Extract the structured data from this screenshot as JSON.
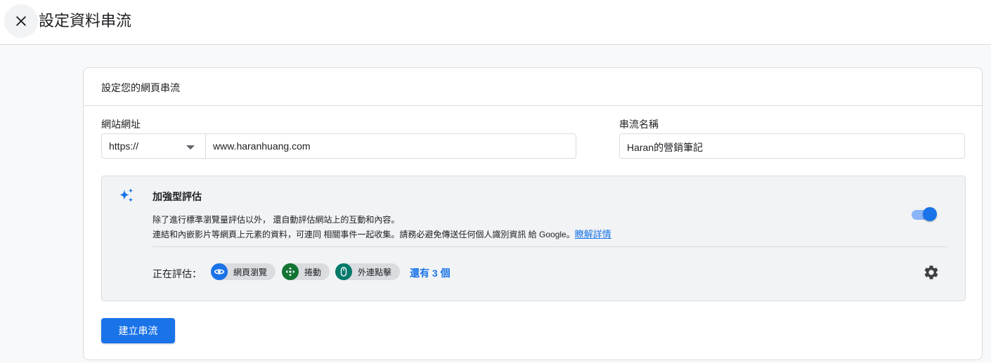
{
  "header": {
    "title": "設定資料串流",
    "close_icon": "close-icon"
  },
  "card": {
    "title": "設定您的網頁串流",
    "website_url": {
      "label": "網站網址",
      "protocol": "https://",
      "value": "www.haranhuang.com"
    },
    "stream_name": {
      "label": "串流名稱",
      "value": "Haran的營銷筆記"
    },
    "enhanced_measurement": {
      "icon": "sparkle-icon",
      "title": "加強型評估",
      "desc_line1": "除了進行標準瀏覽量評估以外， 還自動評估網站上的互動和內容。",
      "desc_line2": "連結和內嵌影片等網頁上元素的資料，可連同 相關事件一起收集。請務必避免傳送任何個人識別資訊 給 Google。",
      "learn_more": "瞭解詳情",
      "toggle_on": true,
      "measuring_label": "正在評估：",
      "events": [
        {
          "label": "網頁瀏覽",
          "icon": "eye-icon",
          "color": "#1a73e8"
        },
        {
          "label": "捲動",
          "icon": "move-icon",
          "color": "#137333"
        },
        {
          "label": "外連點擊",
          "icon": "mouse-icon",
          "color": "#00796b"
        }
      ],
      "more": "還有 3 個",
      "settings_icon": "gear-icon"
    },
    "create_button": "建立串流"
  },
  "colors": {
    "accent": "#1a73e8",
    "toggle_track": "#8ab4f8",
    "panel_bg": "#f1f3f4",
    "border": "#dadce0"
  }
}
